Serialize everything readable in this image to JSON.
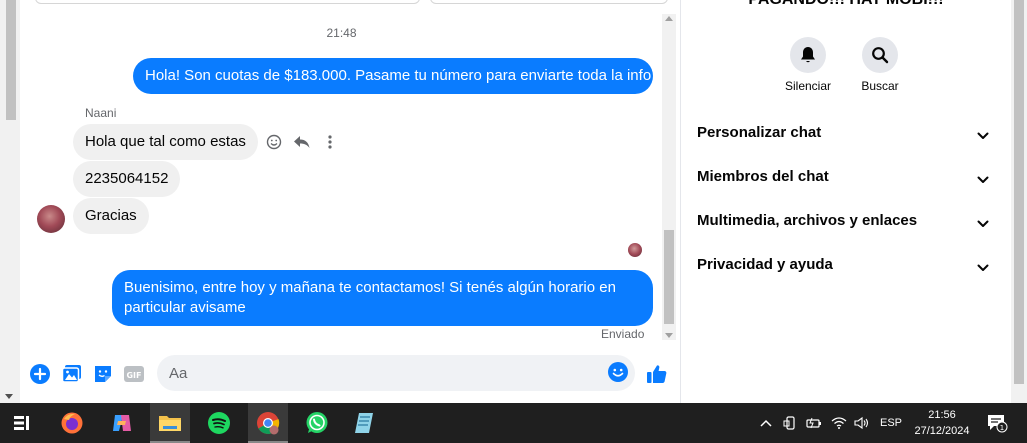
{
  "chat": {
    "timestamp": "21:48",
    "messages": [
      {
        "id": "m1",
        "direction": "outgoing",
        "text": "Hola! Son cuotas de $183.000. Pasame tu número para enviarte toda la info"
      },
      {
        "id": "m2",
        "direction": "incoming",
        "text": "Hola que tal como estas"
      },
      {
        "id": "m3",
        "direction": "incoming",
        "text": "2235064152"
      },
      {
        "id": "m4",
        "direction": "incoming",
        "text": "Gracias"
      },
      {
        "id": "m5",
        "direction": "outgoing",
        "text": "Buenisimo, entre hoy y mañana te contactamos! Si tenés algún horario en particular avisame"
      }
    ],
    "sender_name": "Naani",
    "status": "Enviado",
    "composer": {
      "placeholder": "Aa"
    }
  },
  "sidebar": {
    "title": "PAGANDO!!! HAY MOBI!!!",
    "quick_actions": [
      {
        "label": "Silenciar",
        "icon": "bell-icon"
      },
      {
        "label": "Buscar",
        "icon": "search-icon"
      }
    ],
    "sections": [
      {
        "label": "Personalizar chat"
      },
      {
        "label": "Miembros del chat"
      },
      {
        "label": "Multimedia, archivos y enlaces"
      },
      {
        "label": "Privacidad y ayuda"
      }
    ]
  },
  "taskbar": {
    "apps": [
      "task-view",
      "firefox",
      "copilot",
      "file-explorer",
      "spotify",
      "chrome",
      "whatsapp",
      "notepad"
    ],
    "language": "ESP",
    "time": "21:56",
    "date": "27/12/2024",
    "notification_count": "1"
  },
  "colors": {
    "accent": "#0a7cff",
    "bubble_incoming": "#f0f0f0",
    "taskbar": "#1f1f1f"
  }
}
